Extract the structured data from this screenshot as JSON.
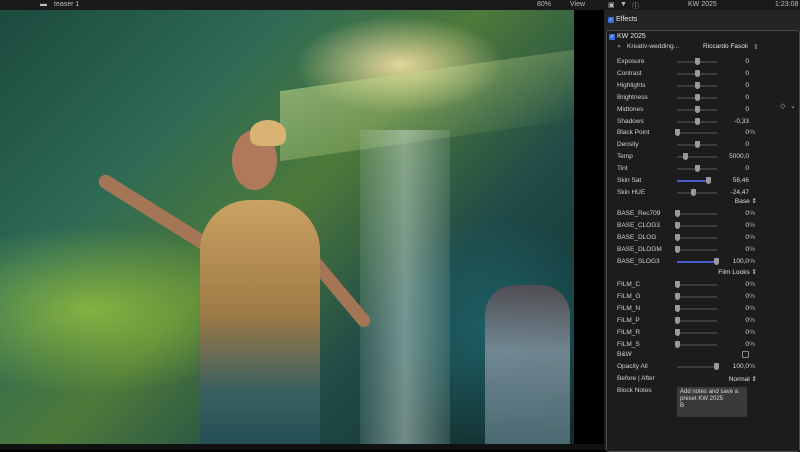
{
  "topbar": {
    "project": "teaser 1",
    "zoom": "80%",
    "view": "View",
    "inspector_title": "KW 2025",
    "timecode": "1:23:08"
  },
  "inspector": {
    "effects_label": "Effects",
    "effect_name": "KW 2025",
    "preset_name": "Kreativ-wedding...",
    "author": "Riccardo Fasoli",
    "rows": [
      {
        "name": "Exposure",
        "value": "0",
        "unit": "",
        "pos": 0.5,
        "active": false
      },
      {
        "name": "Contrast",
        "value": "0",
        "unit": "",
        "pos": 0.5,
        "active": false
      },
      {
        "name": "Highlights",
        "value": "0",
        "unit": "",
        "pos": 0.5,
        "active": false
      },
      {
        "name": "Brightness",
        "value": "0",
        "unit": "",
        "pos": 0.5,
        "active": false
      },
      {
        "name": "Midtones",
        "value": "0",
        "unit": "",
        "pos": 0.5,
        "active": false
      },
      {
        "name": "Shadows",
        "value": "-0,33",
        "unit": "",
        "pos": 0.5,
        "active": false
      },
      {
        "name": "Black Point",
        "value": "0",
        "unit": "%",
        "pos": 0.0,
        "active": false
      },
      {
        "name": "Density",
        "value": "0",
        "unit": "",
        "pos": 0.5,
        "active": false
      },
      {
        "name": "Temp",
        "value": "5000,0",
        "unit": "",
        "pos": 0.2,
        "active": false
      },
      {
        "name": "Tint",
        "value": "0",
        "unit": "",
        "pos": 0.5,
        "active": false
      },
      {
        "name": "Skin Sat",
        "value": "58,46",
        "unit": "",
        "pos": 0.8,
        "active": true
      },
      {
        "name": "Skin HUE",
        "value": "-24,47",
        "unit": "",
        "pos": 0.4,
        "active": false
      },
      {
        "name": "BASE_Rec709",
        "value": "0",
        "unit": "%",
        "pos": 0.0,
        "active": false
      },
      {
        "name": "BASE_CLOG3",
        "value": "0",
        "unit": "%",
        "pos": 0.0,
        "active": false
      },
      {
        "name": "BASE_DLOG",
        "value": "0",
        "unit": "%",
        "pos": 0.0,
        "active": false
      },
      {
        "name": "BASE_DLOGM",
        "value": "0",
        "unit": "%",
        "pos": 0.0,
        "active": false
      },
      {
        "name": "BASE_SLOG3",
        "value": "100,0",
        "unit": "%",
        "pos": 1.0,
        "active": true
      },
      {
        "name": "FILM_C",
        "value": "0",
        "unit": "%",
        "pos": 0.0,
        "active": false
      },
      {
        "name": "FILM_G",
        "value": "0",
        "unit": "%",
        "pos": 0.0,
        "active": false
      },
      {
        "name": "FILM_N",
        "value": "0",
        "unit": "%",
        "pos": 0.0,
        "active": false
      },
      {
        "name": "FILM_P",
        "value": "0",
        "unit": "%",
        "pos": 0.0,
        "active": false
      },
      {
        "name": "FILM_R",
        "value": "0",
        "unit": "%",
        "pos": 0.0,
        "active": false
      },
      {
        "name": "FILM_S",
        "value": "0",
        "unit": "%",
        "pos": 0.0,
        "active": false
      }
    ],
    "base_select": "Base",
    "film_select": "Film Looks",
    "bw_label": "B&W",
    "opacity_label": "Opacity All",
    "opacity_value": "100,0",
    "opacity_unit": "%",
    "before_after_label": "Before | After",
    "before_after_value": "Normal",
    "block_notes_label": "Block Notes",
    "block_notes_text": "Add notes and save a preset KW 2025\nB"
  }
}
